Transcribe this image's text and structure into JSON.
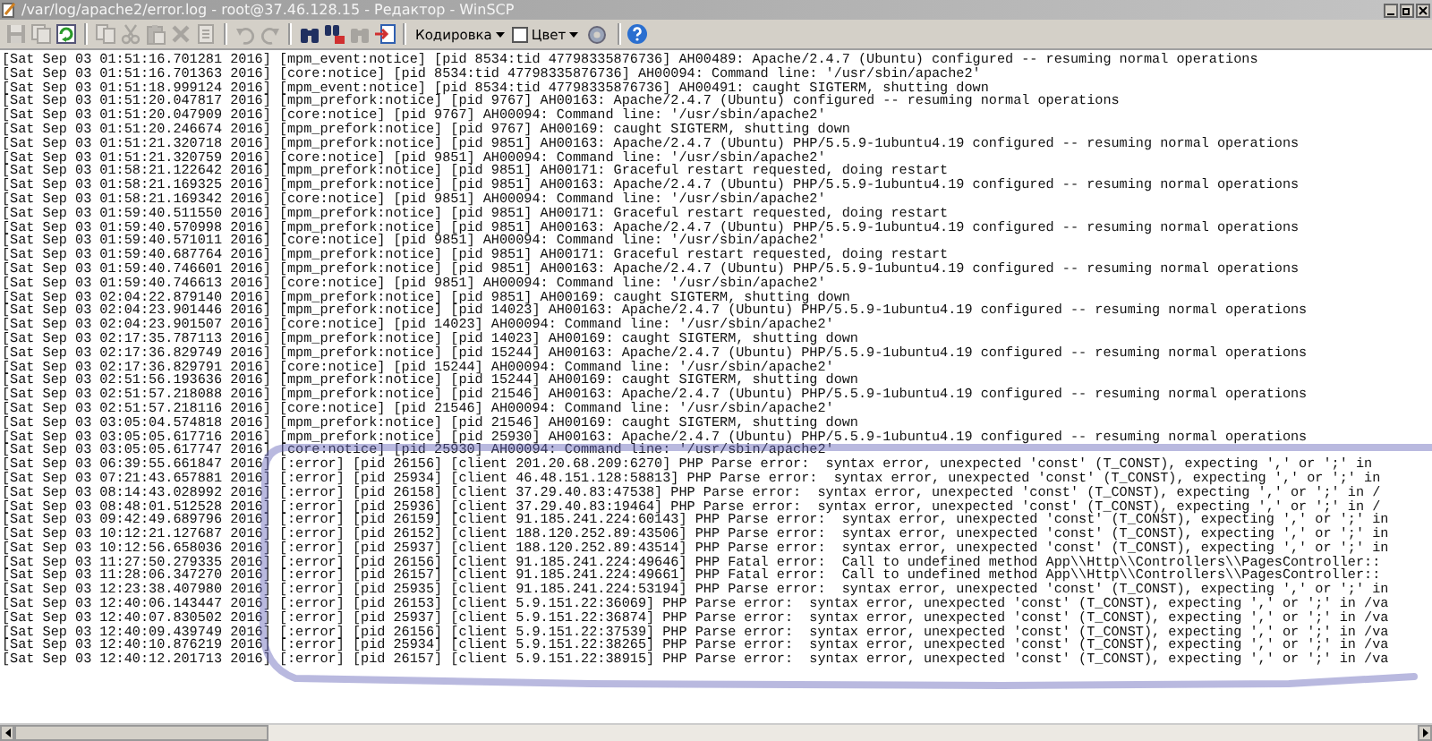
{
  "window": {
    "title": "/var/log/apache2/error.log - root@37.46.128.15 - Редактор - WinSCP"
  },
  "toolbar": {
    "groups": [
      [
        {
          "kind": "save",
          "disabled": true
        },
        {
          "kind": "pages",
          "disabled": true
        },
        {
          "kind": "refresh",
          "disabled": false
        }
      ],
      [
        {
          "kind": "copy",
          "disabled": true
        },
        {
          "kind": "cut",
          "disabled": true
        },
        {
          "kind": "paste",
          "disabled": true
        },
        {
          "kind": "delete",
          "disabled": true
        },
        {
          "kind": "select",
          "disabled": true
        }
      ],
      [
        {
          "kind": "undo",
          "disabled": true
        },
        {
          "kind": "redo",
          "disabled": true
        }
      ],
      [
        {
          "kind": "find",
          "disabled": false
        },
        {
          "kind": "replace",
          "disabled": false
        },
        {
          "kind": "findnext",
          "disabled": true
        },
        {
          "kind": "goto",
          "disabled": false
        }
      ]
    ],
    "encoding_menu": {
      "label": "Кодировка"
    },
    "color_toggle": {
      "label": "Цвет",
      "checked": false
    }
  },
  "log_lines": [
    "[Sat Sep 03 01:51:16.701281 2016] [mpm_event:notice] [pid 8534:tid 47798335876736] AH00489: Apache/2.4.7 (Ubuntu) configured -- resuming normal operations",
    "[Sat Sep 03 01:51:16.701363 2016] [core:notice] [pid 8534:tid 47798335876736] AH00094: Command line: '/usr/sbin/apache2'",
    "[Sat Sep 03 01:51:18.999124 2016] [mpm_event:notice] [pid 8534:tid 47798335876736] AH00491: caught SIGTERM, shutting down",
    "[Sat Sep 03 01:51:20.047817 2016] [mpm_prefork:notice] [pid 9767] AH00163: Apache/2.4.7 (Ubuntu) configured -- resuming normal operations",
    "[Sat Sep 03 01:51:20.047909 2016] [core:notice] [pid 9767] AH00094: Command line: '/usr/sbin/apache2'",
    "[Sat Sep 03 01:51:20.246674 2016] [mpm_prefork:notice] [pid 9767] AH00169: caught SIGTERM, shutting down",
    "[Sat Sep 03 01:51:21.320718 2016] [mpm_prefork:notice] [pid 9851] AH00163: Apache/2.4.7 (Ubuntu) PHP/5.5.9-1ubuntu4.19 configured -- resuming normal operations",
    "[Sat Sep 03 01:51:21.320759 2016] [core:notice] [pid 9851] AH00094: Command line: '/usr/sbin/apache2'",
    "[Sat Sep 03 01:58:21.122642 2016] [mpm_prefork:notice] [pid 9851] AH00171: Graceful restart requested, doing restart",
    "[Sat Sep 03 01:58:21.169325 2016] [mpm_prefork:notice] [pid 9851] AH00163: Apache/2.4.7 (Ubuntu) PHP/5.5.9-1ubuntu4.19 configured -- resuming normal operations",
    "[Sat Sep 03 01:58:21.169342 2016] [core:notice] [pid 9851] AH00094: Command line: '/usr/sbin/apache2'",
    "[Sat Sep 03 01:59:40.511550 2016] [mpm_prefork:notice] [pid 9851] AH00171: Graceful restart requested, doing restart",
    "[Sat Sep 03 01:59:40.570998 2016] [mpm_prefork:notice] [pid 9851] AH00163: Apache/2.4.7 (Ubuntu) PHP/5.5.9-1ubuntu4.19 configured -- resuming normal operations",
    "[Sat Sep 03 01:59:40.571011 2016] [core:notice] [pid 9851] AH00094: Command line: '/usr/sbin/apache2'",
    "[Sat Sep 03 01:59:40.687764 2016] [mpm_prefork:notice] [pid 9851] AH00171: Graceful restart requested, doing restart",
    "[Sat Sep 03 01:59:40.746601 2016] [mpm_prefork:notice] [pid 9851] AH00163: Apache/2.4.7 (Ubuntu) PHP/5.5.9-1ubuntu4.19 configured -- resuming normal operations",
    "[Sat Sep 03 01:59:40.746613 2016] [core:notice] [pid 9851] AH00094: Command line: '/usr/sbin/apache2'",
    "[Sat Sep 03 02:04:22.879140 2016] [mpm_prefork:notice] [pid 9851] AH00169: caught SIGTERM, shutting down",
    "[Sat Sep 03 02:04:23.901446 2016] [mpm_prefork:notice] [pid 14023] AH00163: Apache/2.4.7 (Ubuntu) PHP/5.5.9-1ubuntu4.19 configured -- resuming normal operations",
    "[Sat Sep 03 02:04:23.901507 2016] [core:notice] [pid 14023] AH00094: Command line: '/usr/sbin/apache2'",
    "[Sat Sep 03 02:17:35.787113 2016] [mpm_prefork:notice] [pid 14023] AH00169: caught SIGTERM, shutting down",
    "[Sat Sep 03 02:17:36.829749 2016] [mpm_prefork:notice] [pid 15244] AH00163: Apache/2.4.7 (Ubuntu) PHP/5.5.9-1ubuntu4.19 configured -- resuming normal operations",
    "[Sat Sep 03 02:17:36.829791 2016] [core:notice] [pid 15244] AH00094: Command line: '/usr/sbin/apache2'",
    "[Sat Sep 03 02:51:56.193636 2016] [mpm_prefork:notice] [pid 15244] AH00169: caught SIGTERM, shutting down",
    "[Sat Sep 03 02:51:57.218088 2016] [mpm_prefork:notice] [pid 21546] AH00163: Apache/2.4.7 (Ubuntu) PHP/5.5.9-1ubuntu4.19 configured -- resuming normal operations",
    "[Sat Sep 03 02:51:57.218116 2016] [core:notice] [pid 21546] AH00094: Command line: '/usr/sbin/apache2'",
    "[Sat Sep 03 03:05:04.574818 2016] [mpm_prefork:notice] [pid 21546] AH00169: caught SIGTERM, shutting down",
    "[Sat Sep 03 03:05:05.617716 2016] [mpm_prefork:notice] [pid 25930] AH00163: Apache/2.4.7 (Ubuntu) PHP/5.5.9-1ubuntu4.19 configured -- resuming normal operations",
    "[Sat Sep 03 03:05:05.617747 2016] [core:notice] [pid 25930] AH00094: Command line: '/usr/sbin/apache2'",
    "[Sat Sep 03 06:39:55.661847 2016] [:error] [pid 26156] [client 201.20.68.209:6270] PHP Parse error:  syntax error, unexpected 'const' (T_CONST), expecting ',' or ';' in",
    "[Sat Sep 03 07:21:43.657881 2016] [:error] [pid 25934] [client 46.48.151.128:58813] PHP Parse error:  syntax error, unexpected 'const' (T_CONST), expecting ',' or ';' in",
    "[Sat Sep 03 08:14:43.028992 2016] [:error] [pid 26158] [client 37.29.40.83:47538] PHP Parse error:  syntax error, unexpected 'const' (T_CONST), expecting ',' or ';' in /",
    "[Sat Sep 03 08:48:01.512528 2016] [:error] [pid 25936] [client 37.29.40.83:19464] PHP Parse error:  syntax error, unexpected 'const' (T_CONST), expecting ',' or ';' in /",
    "[Sat Sep 03 09:42:49.689796 2016] [:error] [pid 26159] [client 91.185.241.224:60143] PHP Parse error:  syntax error, unexpected 'const' (T_CONST), expecting ',' or ';' in",
    "[Sat Sep 03 10:12:21.127687 2016] [:error] [pid 26152] [client 188.120.252.89:43506] PHP Parse error:  syntax error, unexpected 'const' (T_CONST), expecting ',' or ';' in",
    "[Sat Sep 03 10:12:56.658036 2016] [:error] [pid 25937] [client 188.120.252.89:43514] PHP Parse error:  syntax error, unexpected 'const' (T_CONST), expecting ',' or ';' in",
    "[Sat Sep 03 11:27:50.279335 2016] [:error] [pid 26156] [client 91.185.241.224:49646] PHP Fatal error:  Call to undefined method App\\\\Http\\\\Controllers\\\\PagesController::",
    "[Sat Sep 03 11:28:06.347270 2016] [:error] [pid 26157] [client 91.185.241.224:49661] PHP Fatal error:  Call to undefined method App\\\\Http\\\\Controllers\\\\PagesController::",
    "[Sat Sep 03 12:23:38.407980 2016] [:error] [pid 25935] [client 91.185.241.224:53194] PHP Parse error:  syntax error, unexpected 'const' (T_CONST), expecting ',' or ';' in",
    "[Sat Sep 03 12:40:06.143447 2016] [:error] [pid 26153] [client 5.9.151.22:36069] PHP Parse error:  syntax error, unexpected 'const' (T_CONST), expecting ',' or ';' in /va",
    "[Sat Sep 03 12:40:07.830502 2016] [:error] [pid 25937] [client 5.9.151.22:36874] PHP Parse error:  syntax error, unexpected 'const' (T_CONST), expecting ',' or ';' in /va",
    "[Sat Sep 03 12:40:09.439749 2016] [:error] [pid 26156] [client 5.9.151.22:37539] PHP Parse error:  syntax error, unexpected 'const' (T_CONST), expecting ',' or ';' in /va",
    "[Sat Sep 03 12:40:10.876219 2016] [:error] [pid 25934] [client 5.9.151.22:38265] PHP Parse error:  syntax error, unexpected 'const' (T_CONST), expecting ',' or ';' in /va",
    "[Sat Sep 03 12:40:12.201713 2016] [:error] [pid 26157] [client 5.9.151.22:38915] PHP Parse error:  syntax error, unexpected 'const' (T_CONST), expecting ',' or ';' in /va"
  ]
}
